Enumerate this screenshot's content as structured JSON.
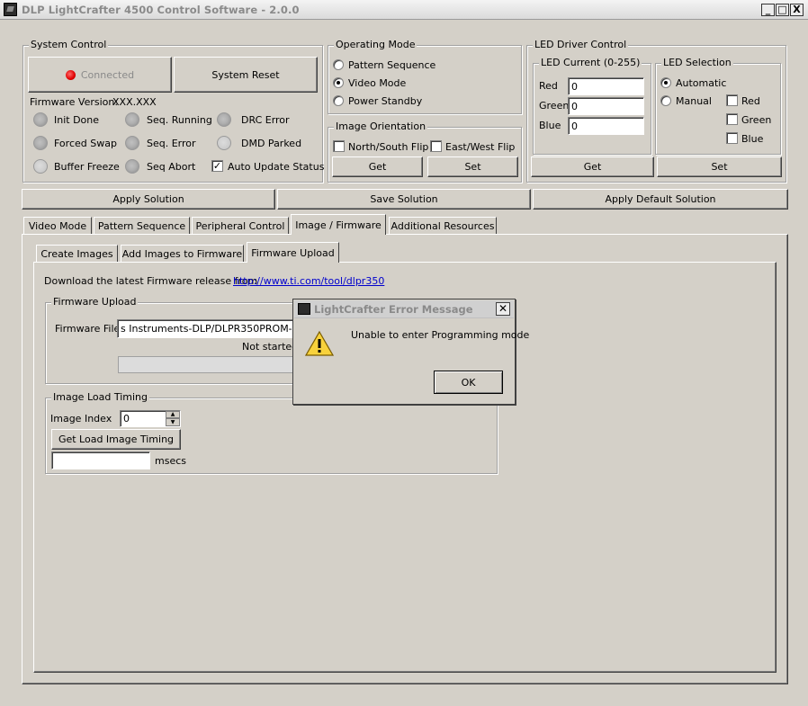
{
  "window": {
    "title": "DLP LightCrafter 4500 Control Software - 2.0.0",
    "minimize": "_",
    "maximize": "□",
    "close": "X"
  },
  "system_control": {
    "legend": "System Control",
    "connected": "Connected",
    "system_reset": "System Reset",
    "firmware_version_label": "Firmware Version:",
    "firmware_version_value": "XXX.XXX",
    "status": {
      "init_done": "Init Done",
      "seq_running": "Seq. Running",
      "drc_error": "DRC Error",
      "forced_swap": "Forced Swap",
      "seq_error": "Seq. Error",
      "dmd_parked": "DMD Parked",
      "buffer_freeze": "Buffer Freeze",
      "seq_abort": "Seq Abort"
    },
    "auto_update_status": "Auto Update Status",
    "auto_update_checked": "✓"
  },
  "operating_mode": {
    "legend": "Operating Mode",
    "options": [
      "Pattern Sequence",
      "Video Mode",
      "Power Standby"
    ],
    "selected": "Video Mode"
  },
  "image_orientation": {
    "legend": "Image Orientation",
    "north_south": "North/South Flip",
    "east_west": "East/West Flip",
    "get": "Get",
    "set": "Set"
  },
  "led_driver": {
    "legend": "LED Driver Control",
    "current_legend": "LED Current (0-255)",
    "red_label": "Red",
    "red_value": "0",
    "green_label": "Green",
    "green_value": "0",
    "blue_label": "Blue",
    "blue_value": "0",
    "selection_legend": "LED Selection",
    "automatic": "Automatic",
    "manual": "Manual",
    "sel_red": "Red",
    "sel_green": "Green",
    "sel_blue": "Blue",
    "get": "Get",
    "set": "Set"
  },
  "solution": {
    "apply": "Apply Solution",
    "save": "Save Solution",
    "apply_default": "Apply Default Solution"
  },
  "main_tabs": [
    "Video Mode",
    "Pattern Sequence",
    "Peripheral Control",
    "Image / Firmware",
    "Additional Resources"
  ],
  "sub_tabs": [
    "Create Images",
    "Add Images to Firmware",
    "Firmware Upload"
  ],
  "firmware_upload": {
    "download_text": "Download the latest Firmware release from",
    "download_link": "http://www.ti.com/tool/dlpr350",
    "group_legend": "Firmware Upload",
    "file_label": "Firmware File:",
    "file_value": "s Instruments-DLP/DLPR350PROM-2.0.0",
    "status": "Not started"
  },
  "image_load_timing": {
    "legend": "Image Load Timing",
    "index_label": "Image Index",
    "index_value": "0",
    "get_button": "Get Load Image Timing",
    "result_value": "",
    "units": "msecs"
  },
  "error_dialog": {
    "title": "LightCrafter Error Message",
    "message": "Unable to enter Programming mode",
    "ok": "OK",
    "close": "✕"
  }
}
